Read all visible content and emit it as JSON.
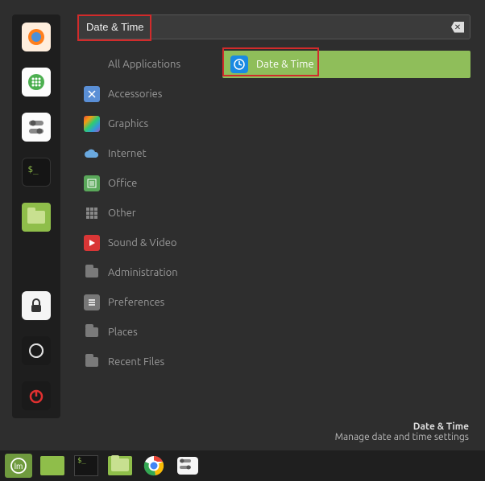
{
  "search": {
    "value": "Date & Time"
  },
  "categories": [
    {
      "label": "All Applications",
      "icon": "none"
    },
    {
      "label": "Accessories",
      "icon": "scissors"
    },
    {
      "label": "Graphics",
      "icon": "rainbow"
    },
    {
      "label": "Internet",
      "icon": "cloud"
    },
    {
      "label": "Office",
      "icon": "office"
    },
    {
      "label": "Other",
      "icon": "grid"
    },
    {
      "label": "Sound & Video",
      "icon": "play"
    },
    {
      "label": "Administration",
      "icon": "folder"
    },
    {
      "label": "Preferences",
      "icon": "prefs"
    },
    {
      "label": "Places",
      "icon": "folder"
    },
    {
      "label": "Recent Files",
      "icon": "folder"
    }
  ],
  "results": [
    {
      "label": "Date & Time",
      "selected": true
    }
  ],
  "footer": {
    "title": "Date & Time",
    "subtitle": "Manage date and time settings"
  },
  "favorites": [
    {
      "name": "firefox"
    },
    {
      "name": "apps"
    },
    {
      "name": "system-settings"
    },
    {
      "name": "terminal"
    },
    {
      "name": "files"
    },
    {
      "name": "lock"
    },
    {
      "name": "logout"
    },
    {
      "name": "power"
    }
  ],
  "taskbar": [
    {
      "name": "start-menu"
    },
    {
      "name": "show-desktop"
    },
    {
      "name": "terminal"
    },
    {
      "name": "files"
    },
    {
      "name": "chrome"
    },
    {
      "name": "system"
    }
  ],
  "colors": {
    "accent": "#8fbe5a",
    "highlight": "#d12b2b"
  }
}
